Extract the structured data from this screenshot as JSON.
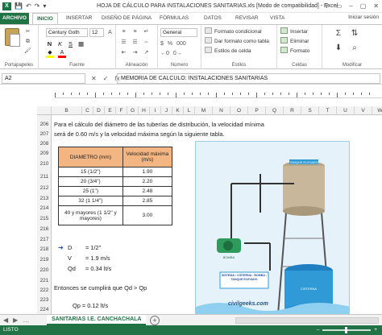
{
  "window": {
    "app_icon": "X",
    "title": "HOJA DE CÁLCULO PARA INSTALACIONES SANITARIAS.xls  [Modo de compatibilidad] - Excel",
    "controls": [
      "?",
      "▭",
      "–",
      "▢",
      "✕"
    ]
  },
  "quick_access": [
    "💾",
    "↶",
    "↷",
    "▾"
  ],
  "ribbon_tabs": [
    "ARCHIVO",
    "INICIO",
    "INSERTAR",
    "DISEÑO DE PÁGINA",
    "FÓRMULAS",
    "DATOS",
    "REVISAR",
    "VISTA"
  ],
  "signin": "Iniciar sesión",
  "ribbon": {
    "paste_label": "Pegar",
    "font_name": "Century Goth",
    "font_size": "12",
    "bold": "N",
    "italic": "K",
    "underline": "S",
    "number_format": "General",
    "number_buttons": [
      "$",
      "%",
      "000",
      "←0",
      "0→"
    ],
    "styles": [
      "Formato condicional",
      "Dar formato como tabla",
      "Estilos de celda"
    ],
    "cells": [
      "Insertar",
      "Eliminar",
      "Formato"
    ],
    "groups": [
      "Portapapeles",
      "Fuente",
      "Alineación",
      "Número",
      "Estilos",
      "Celdas",
      "Modificar"
    ]
  },
  "formula_bar": {
    "name_box": "A2",
    "content": "MEMORIA  DE CALCULO: INSTALACIONES SANITARIAS"
  },
  "columns": [
    "B",
    "C",
    "D",
    "E",
    "F",
    "G",
    "H",
    "I",
    "J",
    "K",
    "L",
    "M",
    "N",
    "O",
    "P",
    "Q",
    "R",
    "S",
    "T",
    "U",
    "V",
    "W"
  ],
  "rows": [
    "206",
    "207",
    "208",
    "209",
    "210",
    "211",
    "212",
    "213",
    "214",
    "215",
    "216",
    "217",
    "218",
    "219",
    "220",
    "221",
    "222",
    "223",
    "224"
  ],
  "content": {
    "para1_line1": "Para el cálculo del diámetro de las tuberías de distribución, la velocidad mínima",
    "para1_line2": "será de 0.60 m/s y la velocidad máxima según la siguiente tabla.",
    "table": {
      "headers": [
        "DIAMETRO (mm)",
        "Velocidad máxima (m/s)"
      ],
      "rows": [
        [
          "15 (1/2\")",
          "1.90"
        ],
        [
          "20 (3/4\")",
          "2.20"
        ],
        [
          "25 (1\")",
          "2.48"
        ],
        [
          "32 (1 1/4\")",
          "2.85"
        ],
        [
          "40 y mayores (1 1/2\" y mayores)",
          "3.00"
        ]
      ]
    },
    "calc": [
      {
        "name": "D",
        "value": "= 1/2\""
      },
      {
        "name": "V",
        "value": "= 1.9 m/s"
      },
      {
        "name": "Qd",
        "value": "= 0.34 lt/s"
      }
    ],
    "conclusion": "Entonces se cumplirá que Qd > Qp",
    "qp_line": "Qp =  0.12 lt/s"
  },
  "illustration": {
    "tank_top": "TANQUE ELEVADO",
    "pump": "BOMBA",
    "legend": "SISTEMA : CISTERNA - BOMBA - TANQUE ELEVADO",
    "cistern": "CISTERNA",
    "watermark": "civilgeeks.com",
    "colors": {
      "water": "#2f9ad6",
      "tank": "#c8b79a",
      "pump": "#2e9a5b",
      "pipe": "#333333"
    }
  },
  "sheet_tab": "SANITARIAS I.E. CANCHACHALA",
  "status": {
    "mode": "LISTO"
  }
}
